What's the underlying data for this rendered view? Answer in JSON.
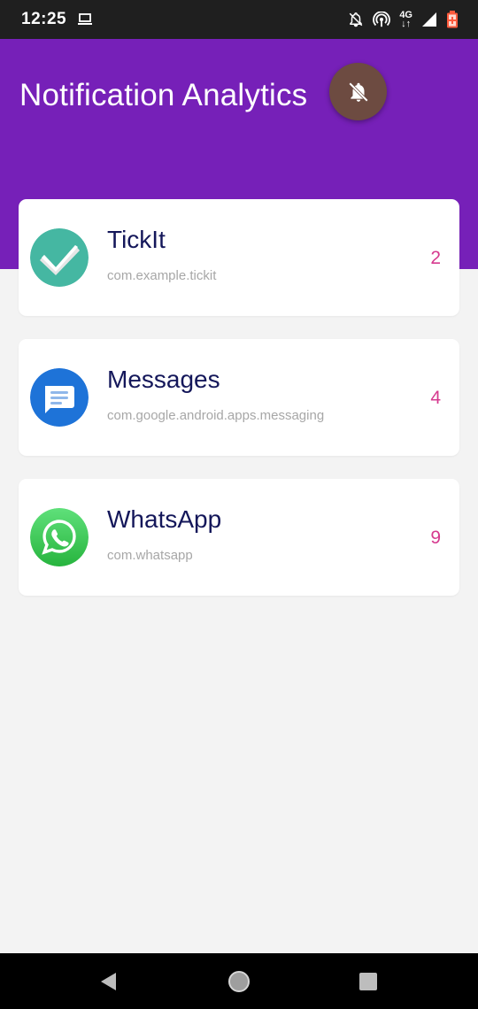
{
  "status_bar": {
    "time": "12:25",
    "network": {
      "top": "4G",
      "bottom": "↓↑"
    },
    "icons": [
      "laptop-icon",
      "notifications-off-icon",
      "hotspot-icon",
      "network-4g-icon",
      "signal-icon",
      "battery-icon"
    ]
  },
  "header": {
    "title": "Notification Analytics",
    "background_color": "#7620b8",
    "mute_button_color": "#6d4b41",
    "mute_button_icon": "bell-off-icon"
  },
  "apps": [
    {
      "name": "TickIt",
      "package": "com.example.tickit",
      "count": "2",
      "icon": "tickit-icon"
    },
    {
      "name": "Messages",
      "package": "com.google.android.apps.messaging",
      "count": "4",
      "icon": "messages-icon"
    },
    {
      "name": "WhatsApp",
      "package": "com.whatsapp",
      "count": "9",
      "icon": "whatsapp-icon"
    }
  ],
  "colors": {
    "count_accent": "#d63a8f",
    "app_name": "#14175a",
    "package_text": "#a7a7a7",
    "page_background": "#f3f3f3"
  },
  "nav_bar": {
    "icons": [
      "back-icon",
      "home-icon",
      "recents-icon"
    ]
  }
}
